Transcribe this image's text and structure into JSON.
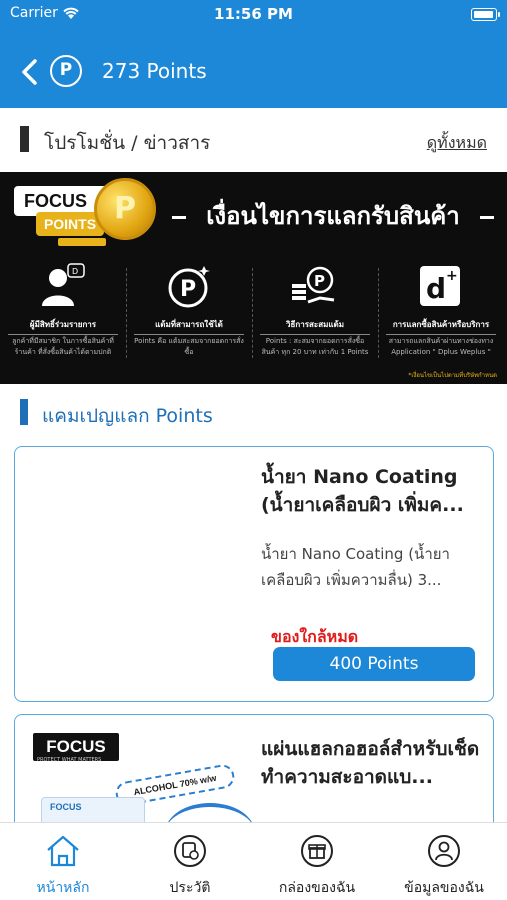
{
  "status_bar": {
    "carrier": "Carrier",
    "time": "11:56 PM"
  },
  "header": {
    "points_title": "273 Points",
    "points_icon": "P"
  },
  "promo_section": {
    "title": "โปรโมชั่น / ข่าวสาร",
    "see_all": "ดูทั้งหมด"
  },
  "banner": {
    "logo": "FOCUS",
    "logo_points": "POINTS",
    "coin_symbol": "P",
    "title": "เงื่อนไขการแลกรับสินค้า",
    "columns": [
      {
        "icon": "user-icon",
        "caption": "ผู้มีสิทธิ์ร่วมรายการ",
        "desc": "ลูกค้าที่มีสมาชิก ในการซื้อสินค้าที่ร้านค้า ที่สั่งซื้อสินค้าได้ตามปกติ"
      },
      {
        "icon": "points-icon",
        "caption": "แต้มที่สามารถใช้ได้",
        "desc": "Points คือ แต้มสะสมจากยอดการสั่งซื้อ"
      },
      {
        "icon": "coins-hand-icon",
        "caption": "วิธีการสะสมแต้ม",
        "desc": "Points : สะสมจากยอดการสั่งซื้อสินค้า ทุก 20 บาท เท่ากับ 1 Points"
      },
      {
        "icon": "dplus-icon",
        "caption": "การแลกซื้อสินค้าหรือบริการ",
        "desc": "สามารถแลกสินค้าผ่านทางช่องทาง Application \" Dplus Weplus \""
      }
    ],
    "note": "*เงื่อนไขเป็นไปตามที่บริษัทกำหนด"
  },
  "campaign_section": {
    "title": "แคมเปญแลก Points"
  },
  "cards": [
    {
      "title": "น้ำยา Nano Coating (น้ำยาเคลือบผิว เพิ่มค...",
      "desc": "น้ำยา Nano Coating (น้ำยาเคลือบผิว เพิ่มความลื่น) 3...",
      "stock_status": "ของใกล้หมด",
      "button": "400 Points"
    },
    {
      "title": "แผ่นแฮลกอฮอล์สำหรับเช็ดทำความสะอาดแบ...",
      "image_logo": "FOCUS",
      "image_tagline": "PROTECT WHAT MATTERS",
      "image_alcohol": "ALCOHOL 70% w/w",
      "image_pack": "FOCUS"
    }
  ],
  "tabbar": {
    "items": [
      {
        "label": "หน้าหลัก",
        "icon": "home-icon",
        "active": true
      },
      {
        "label": "ประวัติ",
        "icon": "history-icon",
        "active": false
      },
      {
        "label": "กล่องของฉัน",
        "icon": "gift-box-icon",
        "active": false
      },
      {
        "label": "ข้อมูลของฉัน",
        "icon": "profile-icon",
        "active": false
      }
    ]
  },
  "colors": {
    "primary": "#1e88d8",
    "warning": "#e21b1b",
    "gold": "#e8b21a"
  }
}
